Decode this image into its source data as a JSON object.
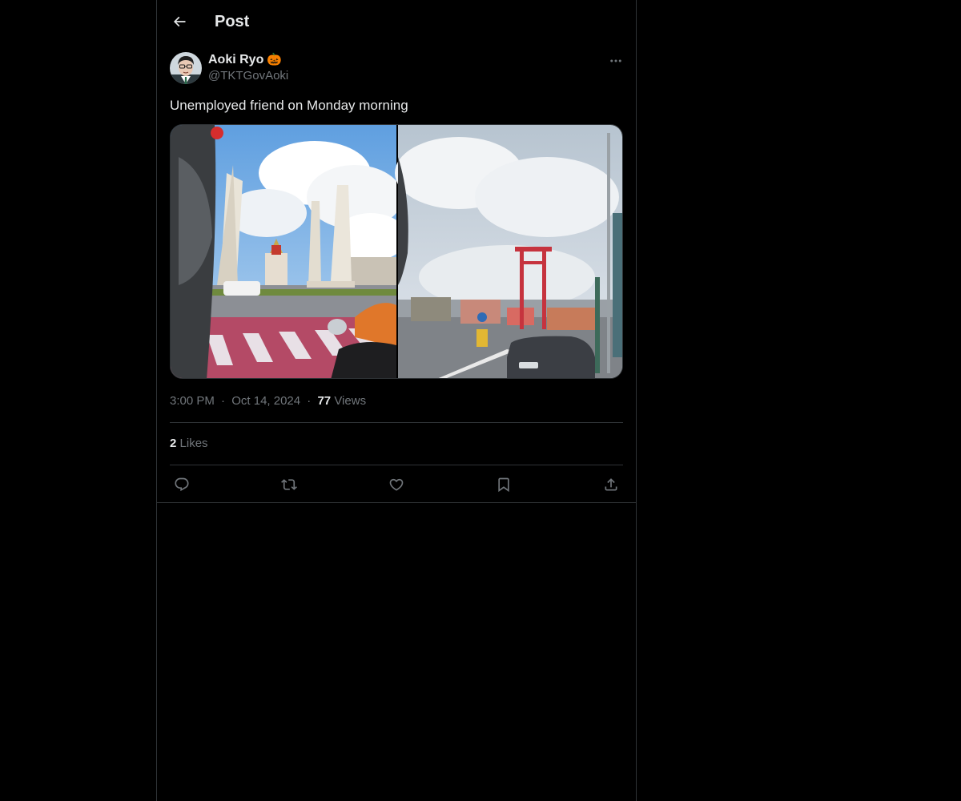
{
  "header": {
    "title": "Post",
    "back_icon": "arrow-left-icon"
  },
  "post": {
    "author": {
      "display_name": "Aoki Ryo",
      "name_emoji": "🎃",
      "handle": "@TKTGovAoki"
    },
    "text": "Unemployed friend on Monday morning",
    "time": "3:00 PM",
    "date": "Oct 14, 2024",
    "separator": "·",
    "views_count": "77",
    "views_label": "Views",
    "likes_count": "2",
    "likes_label": "Likes",
    "actions": [
      {
        "name": "reply",
        "icon": "reply-icon"
      },
      {
        "name": "repost",
        "icon": "repost-icon"
      },
      {
        "name": "like",
        "icon": "heart-icon"
      },
      {
        "name": "bookmark",
        "icon": "bookmark-icon"
      },
      {
        "name": "share",
        "icon": "share-icon"
      }
    ]
  },
  "colors": {
    "background": "#000000",
    "text_primary": "#e7e9ea",
    "text_secondary": "#71767b",
    "border": "#2f3336"
  }
}
